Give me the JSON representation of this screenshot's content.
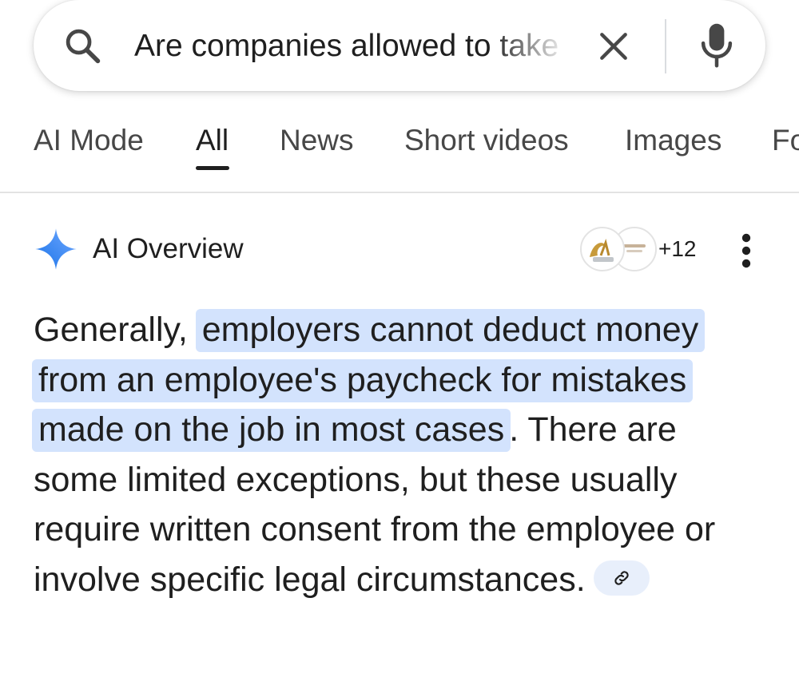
{
  "search": {
    "query": "Are companies allowed to take"
  },
  "tabs": [
    {
      "label": "AI Mode"
    },
    {
      "label": "All"
    },
    {
      "label": "News"
    },
    {
      "label": "Short videos"
    },
    {
      "label": "Images"
    },
    {
      "label": "Fo"
    }
  ],
  "active_tab": "All",
  "ai_overview": {
    "title": "AI Overview",
    "sources_more": "+12",
    "text_intro": "Generally, ",
    "text_highlight": "employers cannot deduct money from an employee's paycheck for mistakes made on the job in most cases",
    "text_rest": ". There are some limited exceptions, but these usually require written consent from the employee or involve specific legal circumstances."
  },
  "colors": {
    "highlight": "#d3e3fd",
    "chip_bg": "#e8effb",
    "sparkle": "#4285f4",
    "text": "#1f1f1f"
  },
  "icons": [
    "search-icon",
    "close-icon",
    "mic-icon",
    "sparkle-icon",
    "more-vert-icon",
    "link-icon"
  ]
}
